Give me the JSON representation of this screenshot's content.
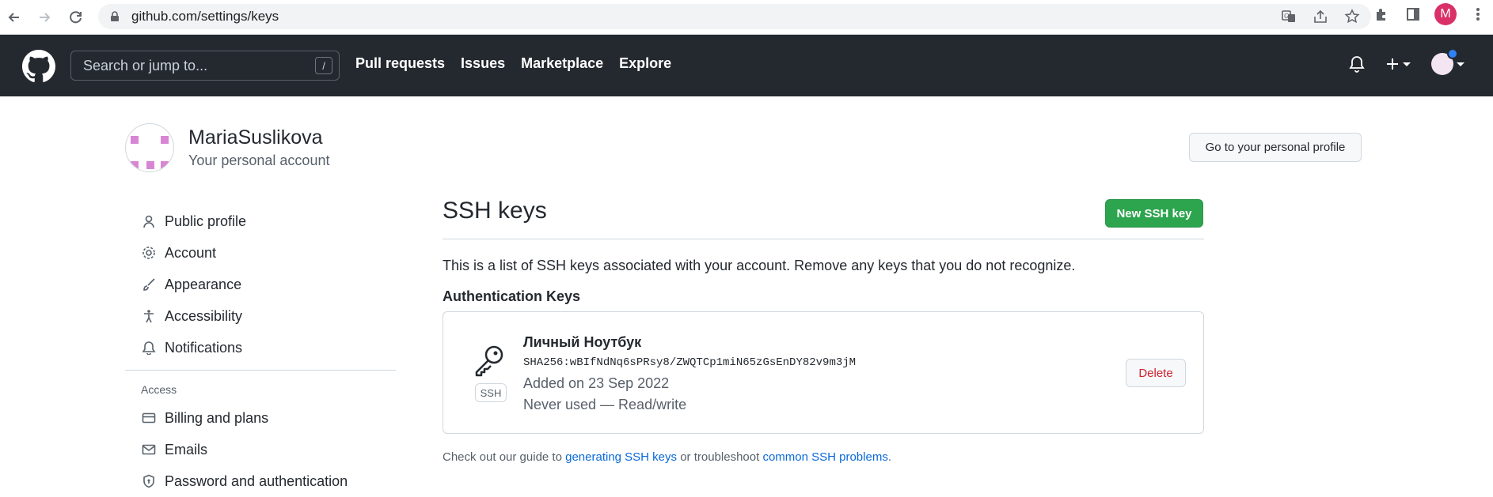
{
  "browser": {
    "url": "github.com/settings/keys",
    "profile_letter": "M",
    "back_icon": "arrow-left-icon",
    "forward_icon": "arrow-right-icon",
    "reload_icon": "reload-icon"
  },
  "header": {
    "search_placeholder": "Search or jump to...",
    "search_shortcut": "/",
    "nav": [
      "Pull requests",
      "Issues",
      "Marketplace",
      "Explore"
    ]
  },
  "account": {
    "username": "MariaSuslikova",
    "subtitle": "Your personal account",
    "profile_button": "Go to your personal profile"
  },
  "sidebar": {
    "items": [
      {
        "label": "Public profile",
        "icon": "person-icon"
      },
      {
        "label": "Account",
        "icon": "gear-icon"
      },
      {
        "label": "Appearance",
        "icon": "paintbrush-icon"
      },
      {
        "label": "Accessibility",
        "icon": "accessibility-icon"
      },
      {
        "label": "Notifications",
        "icon": "bell-icon"
      }
    ],
    "access_heading": "Access",
    "access_items": [
      {
        "label": "Billing and plans",
        "icon": "credit-card-icon"
      },
      {
        "label": "Emails",
        "icon": "mail-icon"
      },
      {
        "label": "Password and authentication",
        "icon": "shield-lock-icon"
      }
    ]
  },
  "main": {
    "title": "SSH keys",
    "new_button": "New SSH key",
    "description": "This is a list of SSH keys associated with your account. Remove any keys that you do not recognize.",
    "auth_heading": "Authentication Keys",
    "key": {
      "title": "Личный Ноутбук",
      "fingerprint": "SHA256:wBIfNdNq6sPRsy8/ZWQTCp1miN65zGsEnDY82v9m3jM",
      "added": "Added on 23 Sep 2022",
      "usage": "Never used — Read/write",
      "badge": "SSH",
      "delete_button": "Delete"
    },
    "footer": {
      "prefix": "Check out our guide to ",
      "link1": "generating SSH keys",
      "middle": " or troubleshoot ",
      "link2": "common SSH problems",
      "suffix": "."
    }
  },
  "colors": {
    "header_bg": "#24292f",
    "primary_green": "#2da44e",
    "danger_red": "#cf222e",
    "link_blue": "#0969da"
  }
}
